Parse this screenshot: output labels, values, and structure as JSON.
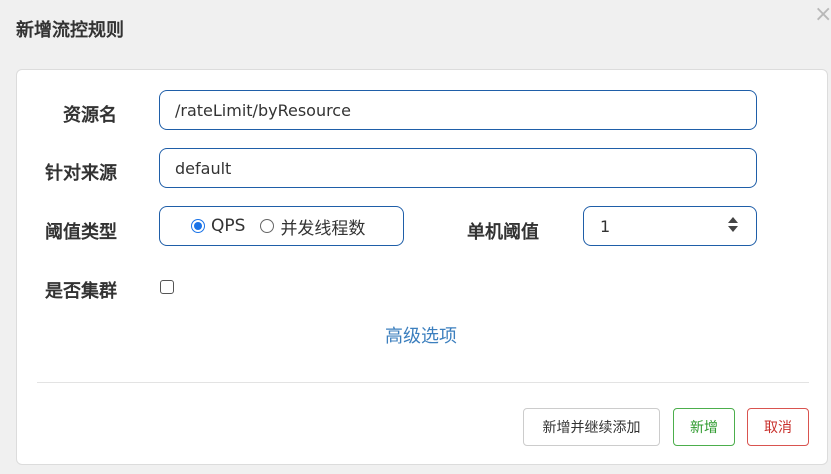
{
  "dialog": {
    "title": "新增流控规则",
    "close_symbol": "×"
  },
  "form": {
    "resource": {
      "label": "资源名",
      "value": "/rateLimit/byResource"
    },
    "limit_app": {
      "label": "针对来源",
      "value": "default"
    },
    "grade": {
      "label": "阈值类型",
      "options": [
        {
          "label": "QPS",
          "checked": true
        },
        {
          "label": "并发线程数",
          "checked": false
        }
      ]
    },
    "count": {
      "label": "单机阈值",
      "value": "1"
    },
    "cluster": {
      "label": "是否集群",
      "checked": false
    },
    "advanced_label": "高级选项"
  },
  "buttons": {
    "add_and_continue": "新增并继续添加",
    "add": "新增",
    "cancel": "取消"
  },
  "colors": {
    "input_border": "#1f5ea8",
    "link": "#3c7fbe",
    "success": "#2e9a2e",
    "danger": "#c9302c",
    "radio_checked": "#1a73e8"
  }
}
